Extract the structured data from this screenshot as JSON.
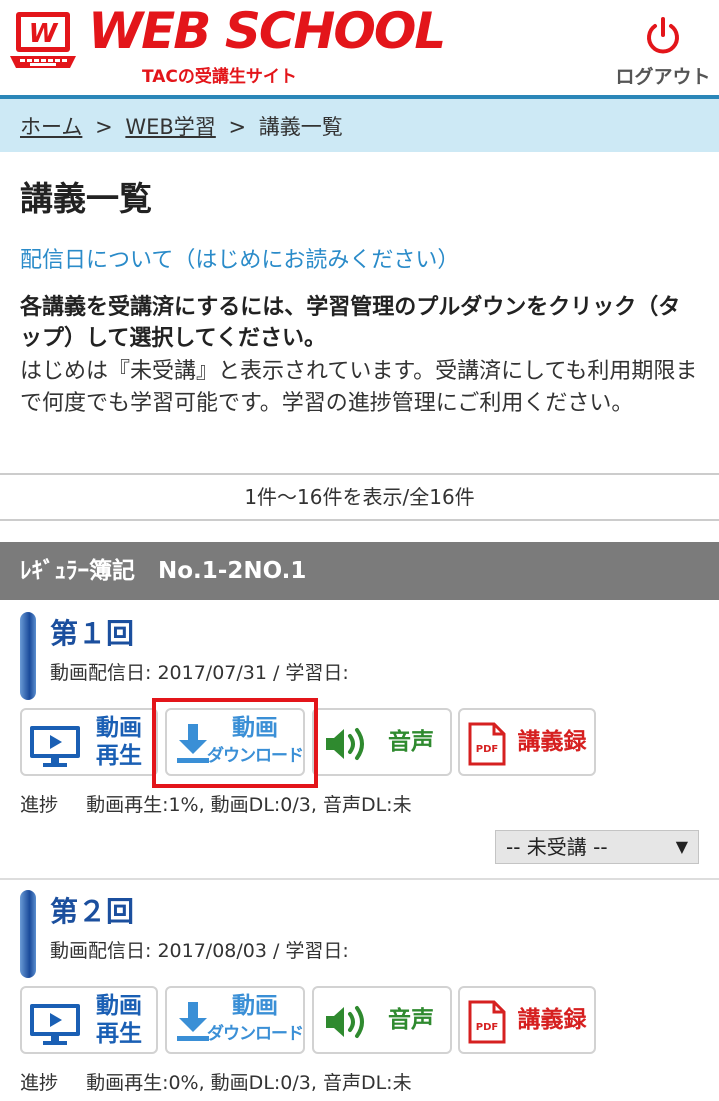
{
  "header": {
    "logo_text": "WEB SCHOOL",
    "logo_sub": "TACの受講生サイト",
    "logout_label": "ログアウト",
    "accent_color": "#e3151a"
  },
  "breadcrumb": {
    "home": "ホーム",
    "web": "WEB学習",
    "current": "講義一覧",
    "separator": ">"
  },
  "page": {
    "title": "講義一覧",
    "intro_link": "配信日について（はじめにお読みください）",
    "intro_bold": "各講義を受講済にするには、学習管理のプルダウンをクリック（タップ）して選択してください。",
    "intro_body": "はじめは『未受講』と表示されています。受講済にしても利用期限まで何度でも学習可能です。学習の進捗管理にご利用ください。",
    "count": "1件〜16件を表示/全16件"
  },
  "course": {
    "title": "ﾚｷﾞｭﾗｰ簿記　No.1-2NO.1"
  },
  "buttons": {
    "play_line1": "動画",
    "play_line2": "再生",
    "dl_line1": "動画",
    "dl_line2": "ダウンロード",
    "audio": "音声",
    "pdf_label": "PDF",
    "notes": "講義録"
  },
  "lectures": [
    {
      "title": "第１回",
      "date": "動画配信日: 2017/07/31 / 学習日:",
      "progress_label": "進捗",
      "progress": "動画再生:1%, 動画DL:0/3, 音声DL:未",
      "status": "-- 未受講 --",
      "status_arrow": "▼"
    },
    {
      "title": "第２回",
      "date": "動画配信日: 2017/08/03 / 学習日:",
      "progress_label": "進捗",
      "progress": "動画再生:0%, 動画DL:0/3, 音声DL:未"
    }
  ]
}
